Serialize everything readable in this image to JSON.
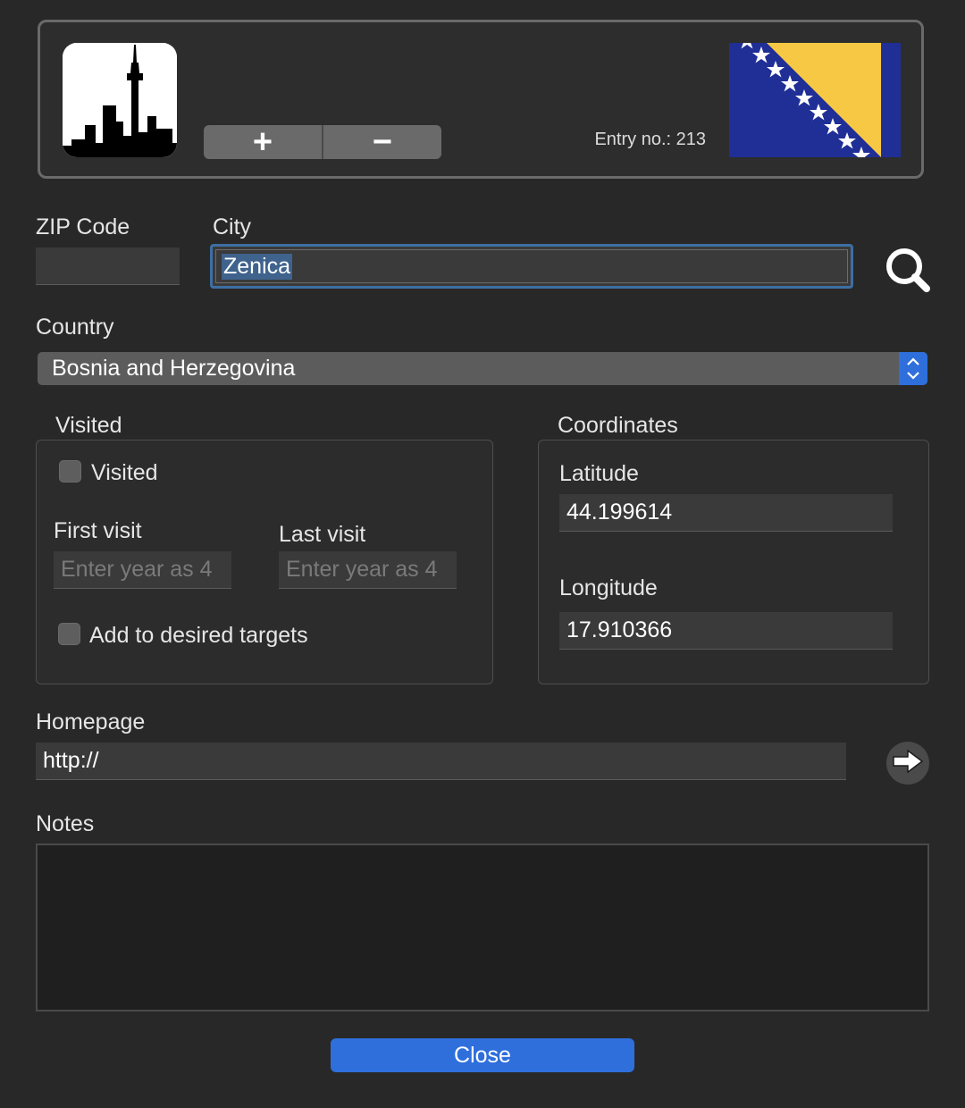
{
  "header": {
    "add_label": "+",
    "remove_label": "−",
    "entry_label": "Entry no.: 213"
  },
  "zip": {
    "label": "ZIP Code",
    "value": ""
  },
  "city": {
    "label": "City",
    "value": "Zenica"
  },
  "country": {
    "label": "Country",
    "value": "Bosnia and Herzegovina"
  },
  "visited": {
    "group_label": "Visited",
    "checkbox_label": "Visited",
    "first_visit_label": "First visit",
    "first_visit_placeholder": "Enter year as 4",
    "last_visit_label": "Last visit",
    "last_visit_placeholder": "Enter year as 4",
    "targets_label": "Add to desired targets"
  },
  "coordinates": {
    "group_label": "Coordinates",
    "latitude_label": "Latitude",
    "latitude_value": "44.199614",
    "longitude_label": "Longitude",
    "longitude_value": "17.910366"
  },
  "homepage": {
    "label": "Homepage",
    "value": "http://"
  },
  "notes": {
    "label": "Notes",
    "value": ""
  },
  "close_label": "Close",
  "icons": {
    "city": "city-skyline-icon",
    "flag": "bosnia-flag-icon",
    "search": "search-icon",
    "go": "arrow-right-icon"
  },
  "colors": {
    "accent": "#2f6fdc",
    "focus_ring": "#3d6fa3",
    "flag_blue": "#1f2f96",
    "flag_yellow": "#f7c843"
  }
}
